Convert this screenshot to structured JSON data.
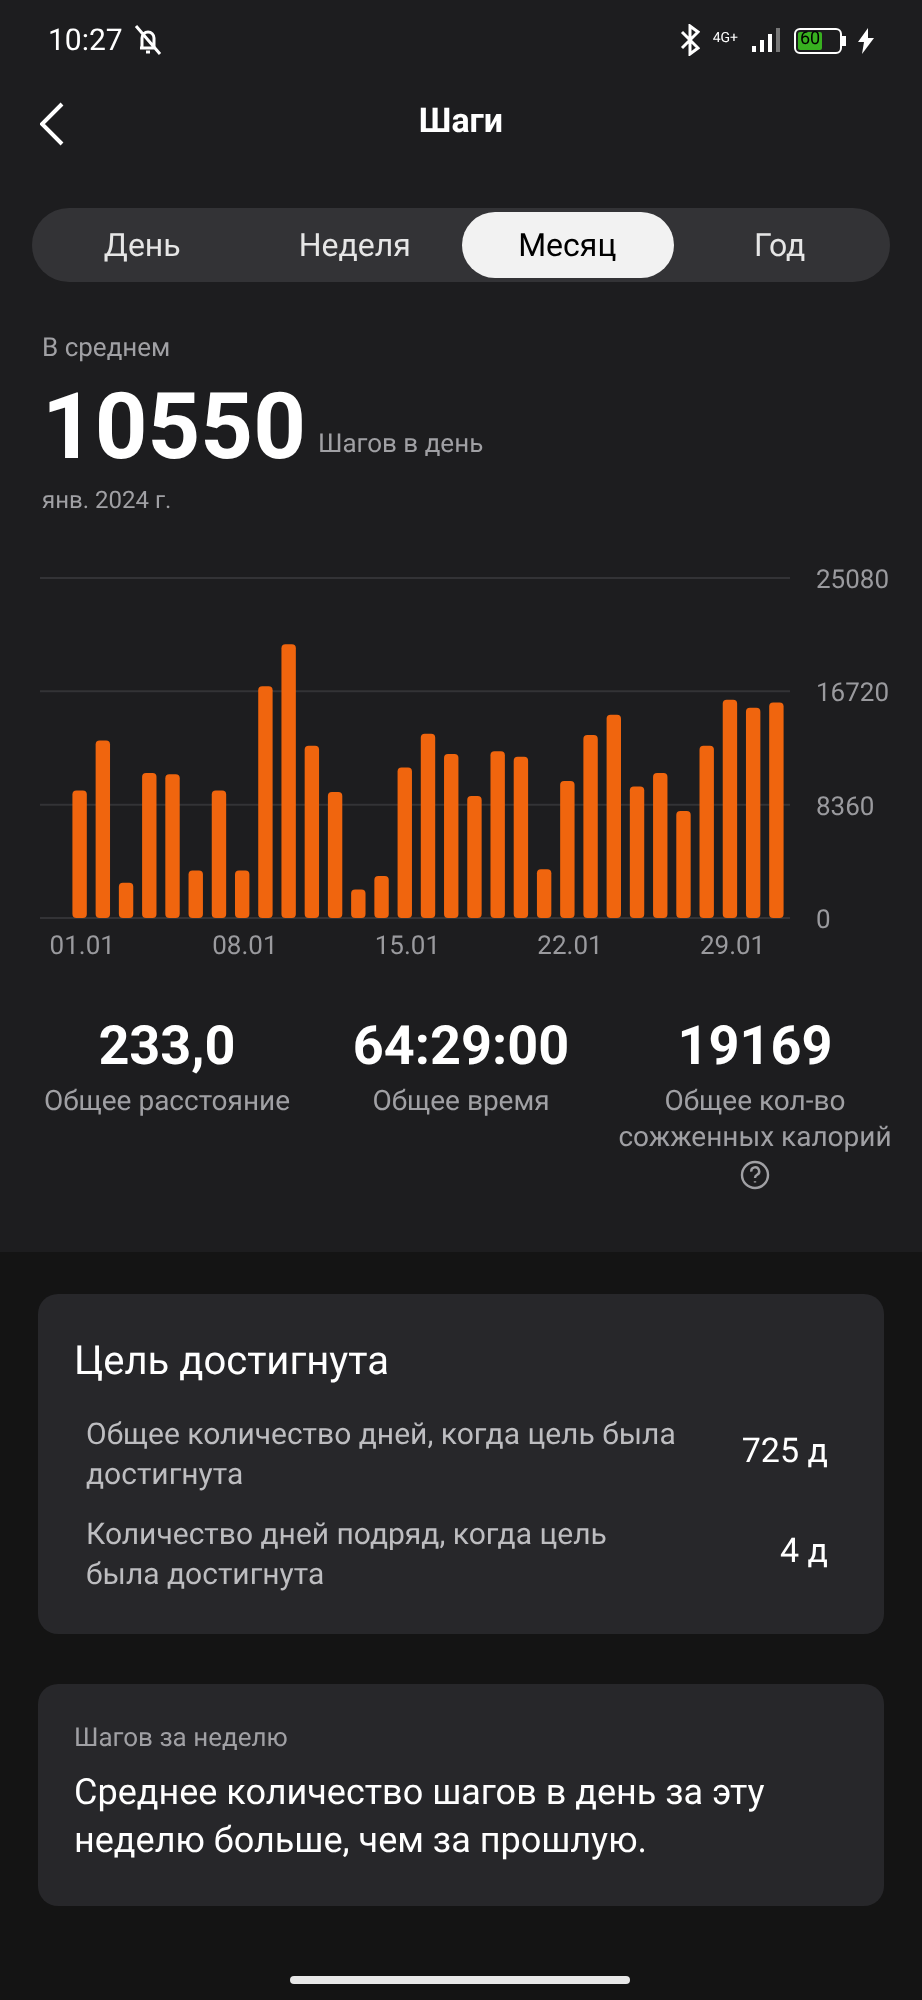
{
  "status_bar": {
    "time": "10:27",
    "network": "4G+",
    "battery": "60",
    "charging": true
  },
  "header": {
    "title": "Шаги"
  },
  "tabs": [
    {
      "label": "День",
      "selected": false
    },
    {
      "label": "Неделя",
      "selected": false
    },
    {
      "label": "Месяц",
      "selected": true
    },
    {
      "label": "Год",
      "selected": false
    }
  ],
  "summary": {
    "caption": "В среднем",
    "value": "10550",
    "unit": "Шагов в день",
    "period": "янв. 2024 г."
  },
  "chart_data": {
    "type": "bar",
    "categories": [
      "01.01",
      null,
      null,
      null,
      null,
      null,
      null,
      "08.01",
      null,
      null,
      null,
      null,
      null,
      null,
      "15.01",
      null,
      null,
      null,
      null,
      null,
      null,
      "22.01",
      null,
      null,
      null,
      null,
      null,
      null,
      "29.01",
      null,
      null
    ],
    "series": [
      {
        "color": "#f0650e",
        "values": [
          9400,
          13100,
          2600,
          10700,
          10600,
          3500,
          9400,
          3500,
          17100,
          20200,
          12700,
          9300,
          2100,
          3100,
          11100,
          13600,
          12100,
          9000,
          12300,
          11900,
          3600,
          10100,
          13500,
          15000,
          9700,
          10700,
          7900,
          12700,
          16100,
          15500,
          15900
        ]
      }
    ],
    "ylim": [
      0,
      25080
    ],
    "yticks": [
      0,
      8360,
      16720,
      25080
    ]
  },
  "stats": [
    {
      "value": "233,0",
      "label": "Общее расстояние",
      "help": false
    },
    {
      "value": "64:29:00",
      "label": "Общее время",
      "help": false
    },
    {
      "value": "19169",
      "label": "Общее кол-во сожженных калорий",
      "help": true
    }
  ],
  "goal_card": {
    "title": "Цель достигнута",
    "rows": [
      {
        "label": "Общее количество дней, когда цель была достигнута",
        "value": "725 д"
      },
      {
        "label": "Количество дней подряд, когда цель была достигнута",
        "value": "4 д"
      }
    ]
  },
  "week_card": {
    "caption": "Шагов за неделю",
    "text": "Среднее количество шагов в день за эту неделю больше, чем за прошлую."
  }
}
